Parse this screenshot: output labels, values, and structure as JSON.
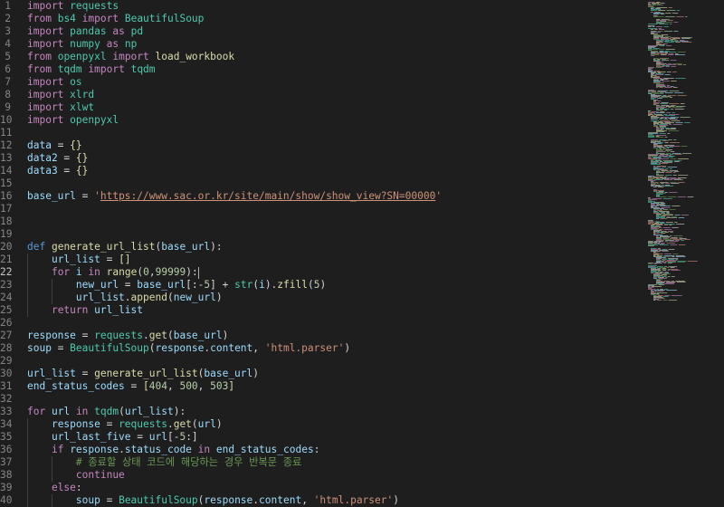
{
  "editor": {
    "active_line": 22,
    "lines": [
      {
        "n": 1,
        "indent": 0,
        "tokens": [
          [
            "kw",
            "import"
          ],
          [
            "op",
            " "
          ],
          [
            "mod",
            "requests"
          ]
        ]
      },
      {
        "n": 2,
        "indent": 0,
        "tokens": [
          [
            "kw",
            "from"
          ],
          [
            "op",
            " "
          ],
          [
            "mod",
            "bs4"
          ],
          [
            "op",
            " "
          ],
          [
            "kw",
            "import"
          ],
          [
            "op",
            " "
          ],
          [
            "mod",
            "BeautifulSoup"
          ]
        ]
      },
      {
        "n": 3,
        "indent": 0,
        "tokens": [
          [
            "kw",
            "import"
          ],
          [
            "op",
            " "
          ],
          [
            "mod",
            "pandas"
          ],
          [
            "op",
            " "
          ],
          [
            "kw",
            "as"
          ],
          [
            "op",
            " "
          ],
          [
            "mod",
            "pd"
          ]
        ]
      },
      {
        "n": 4,
        "indent": 0,
        "tokens": [
          [
            "kw",
            "import"
          ],
          [
            "op",
            " "
          ],
          [
            "mod",
            "numpy"
          ],
          [
            "op",
            " "
          ],
          [
            "kw",
            "as"
          ],
          [
            "op",
            " "
          ],
          [
            "mod",
            "np"
          ]
        ]
      },
      {
        "n": 5,
        "indent": 0,
        "tokens": [
          [
            "kw",
            "from"
          ],
          [
            "op",
            " "
          ],
          [
            "mod",
            "openpyxl"
          ],
          [
            "op",
            " "
          ],
          [
            "kw",
            "import"
          ],
          [
            "op",
            " "
          ],
          [
            "fn",
            "load_workbook"
          ]
        ]
      },
      {
        "n": 6,
        "indent": 0,
        "tokens": [
          [
            "kw",
            "from"
          ],
          [
            "op",
            " "
          ],
          [
            "mod",
            "tqdm"
          ],
          [
            "op",
            " "
          ],
          [
            "kw",
            "import"
          ],
          [
            "op",
            " "
          ],
          [
            "mod",
            "tqdm"
          ]
        ]
      },
      {
        "n": 7,
        "indent": 0,
        "tokens": [
          [
            "kw",
            "import"
          ],
          [
            "op",
            " "
          ],
          [
            "mod",
            "os"
          ]
        ]
      },
      {
        "n": 8,
        "indent": 0,
        "tokens": [
          [
            "kw",
            "import"
          ],
          [
            "op",
            " "
          ],
          [
            "mod",
            "xlrd"
          ]
        ]
      },
      {
        "n": 9,
        "indent": 0,
        "tokens": [
          [
            "kw",
            "import"
          ],
          [
            "op",
            " "
          ],
          [
            "mod",
            "xlwt"
          ]
        ]
      },
      {
        "n": 10,
        "indent": 0,
        "tokens": [
          [
            "kw",
            "import"
          ],
          [
            "op",
            " "
          ],
          [
            "mod",
            "openpyxl"
          ]
        ]
      },
      {
        "n": 11,
        "indent": 0,
        "tokens": []
      },
      {
        "n": 12,
        "indent": 0,
        "tokens": [
          [
            "var",
            "data"
          ],
          [
            "op",
            " = "
          ],
          [
            "fn",
            "{}"
          ]
        ]
      },
      {
        "n": 13,
        "indent": 0,
        "tokens": [
          [
            "var",
            "data2"
          ],
          [
            "op",
            " = "
          ],
          [
            "fn",
            "{}"
          ]
        ]
      },
      {
        "n": 14,
        "indent": 0,
        "tokens": [
          [
            "var",
            "data3"
          ],
          [
            "op",
            " = "
          ],
          [
            "fn",
            "{}"
          ]
        ]
      },
      {
        "n": 15,
        "indent": 0,
        "tokens": []
      },
      {
        "n": 16,
        "indent": 0,
        "tokens": [
          [
            "var",
            "base_url"
          ],
          [
            "op",
            " = "
          ],
          [
            "str",
            "'"
          ],
          [
            "url",
            "https://www.sac.or.kr/site/main/show/show_view?SN=00000"
          ],
          [
            "str",
            "'"
          ]
        ]
      },
      {
        "n": 17,
        "indent": 0,
        "tokens": []
      },
      {
        "n": 18,
        "indent": 0,
        "tokens": []
      },
      {
        "n": 19,
        "indent": 0,
        "tokens": []
      },
      {
        "n": 20,
        "indent": 0,
        "tokens": [
          [
            "dec",
            "def"
          ],
          [
            "op",
            " "
          ],
          [
            "fn",
            "generate_url_list"
          ],
          [
            "op",
            "("
          ],
          [
            "var",
            "base_url"
          ],
          [
            "op",
            "):"
          ]
        ]
      },
      {
        "n": 21,
        "indent": 1,
        "tokens": [
          [
            "var",
            "url_list"
          ],
          [
            "op",
            " = "
          ],
          [
            "fn",
            "[]"
          ]
        ]
      },
      {
        "n": 22,
        "indent": 1,
        "tokens": [
          [
            "kw",
            "for"
          ],
          [
            "op",
            " "
          ],
          [
            "var",
            "i"
          ],
          [
            "op",
            " "
          ],
          [
            "kw",
            "in"
          ],
          [
            "op",
            " "
          ],
          [
            "fn",
            "range"
          ],
          [
            "op",
            "("
          ],
          [
            "num",
            "0"
          ],
          [
            "op",
            ","
          ],
          [
            "num",
            "99999"
          ],
          [
            "op",
            "):"
          ]
        ]
      },
      {
        "n": 23,
        "indent": 2,
        "tokens": [
          [
            "var",
            "new_url"
          ],
          [
            "op",
            " = "
          ],
          [
            "var",
            "base_url"
          ],
          [
            "op",
            "[:-"
          ],
          [
            "num",
            "5"
          ],
          [
            "op",
            "] + "
          ],
          [
            "mod",
            "str"
          ],
          [
            "op",
            "("
          ],
          [
            "var",
            "i"
          ],
          [
            "op",
            ")."
          ],
          [
            "fn",
            "zfill"
          ],
          [
            "op",
            "("
          ],
          [
            "num",
            "5"
          ],
          [
            "op",
            ")"
          ]
        ]
      },
      {
        "n": 24,
        "indent": 2,
        "tokens": [
          [
            "var",
            "url_list"
          ],
          [
            "op",
            "."
          ],
          [
            "fn",
            "append"
          ],
          [
            "op",
            "("
          ],
          [
            "var",
            "new_url"
          ],
          [
            "op",
            ")"
          ]
        ]
      },
      {
        "n": 25,
        "indent": 1,
        "tokens": [
          [
            "kw",
            "return"
          ],
          [
            "op",
            " "
          ],
          [
            "var",
            "url_list"
          ]
        ]
      },
      {
        "n": 26,
        "indent": 0,
        "tokens": []
      },
      {
        "n": 27,
        "indent": 0,
        "tokens": [
          [
            "var",
            "response"
          ],
          [
            "op",
            " = "
          ],
          [
            "mod",
            "requests"
          ],
          [
            "op",
            "."
          ],
          [
            "fn",
            "get"
          ],
          [
            "op",
            "("
          ],
          [
            "var",
            "base_url"
          ],
          [
            "op",
            ")"
          ]
        ]
      },
      {
        "n": 28,
        "indent": 0,
        "tokens": [
          [
            "var",
            "soup"
          ],
          [
            "op",
            " = "
          ],
          [
            "mod",
            "BeautifulSoup"
          ],
          [
            "op",
            "("
          ],
          [
            "var",
            "response"
          ],
          [
            "op",
            "."
          ],
          [
            "var",
            "content"
          ],
          [
            "op",
            ", "
          ],
          [
            "str",
            "'html.parser'"
          ],
          [
            "op",
            ")"
          ]
        ]
      },
      {
        "n": 29,
        "indent": 0,
        "tokens": []
      },
      {
        "n": 30,
        "indent": 0,
        "tokens": [
          [
            "var",
            "url_list"
          ],
          [
            "op",
            " = "
          ],
          [
            "fn",
            "generate_url_list"
          ],
          [
            "op",
            "("
          ],
          [
            "var",
            "base_url"
          ],
          [
            "op",
            ")"
          ]
        ]
      },
      {
        "n": 31,
        "indent": 0,
        "tokens": [
          [
            "var",
            "end_status_codes"
          ],
          [
            "op",
            " = "
          ],
          [
            "fn",
            "["
          ],
          [
            "num",
            "404"
          ],
          [
            "op",
            ", "
          ],
          [
            "num",
            "500"
          ],
          [
            "op",
            ", "
          ],
          [
            "num",
            "503"
          ],
          [
            "fn",
            "]"
          ]
        ]
      },
      {
        "n": 32,
        "indent": 0,
        "tokens": []
      },
      {
        "n": 33,
        "indent": 0,
        "tokens": [
          [
            "kw",
            "for"
          ],
          [
            "op",
            " "
          ],
          [
            "var",
            "url"
          ],
          [
            "op",
            " "
          ],
          [
            "kw",
            "in"
          ],
          [
            "op",
            " "
          ],
          [
            "mod",
            "tqdm"
          ],
          [
            "op",
            "("
          ],
          [
            "var",
            "url_list"
          ],
          [
            "op",
            "):"
          ]
        ]
      },
      {
        "n": 34,
        "indent": 1,
        "tokens": [
          [
            "var",
            "response"
          ],
          [
            "op",
            " = "
          ],
          [
            "mod",
            "requests"
          ],
          [
            "op",
            "."
          ],
          [
            "fn",
            "get"
          ],
          [
            "op",
            "("
          ],
          [
            "var",
            "url"
          ],
          [
            "op",
            ")"
          ]
        ]
      },
      {
        "n": 35,
        "indent": 1,
        "tokens": [
          [
            "var",
            "url_last_five"
          ],
          [
            "op",
            " = "
          ],
          [
            "var",
            "url"
          ],
          [
            "op",
            "[-"
          ],
          [
            "num",
            "5"
          ],
          [
            "op",
            ":]"
          ]
        ]
      },
      {
        "n": 36,
        "indent": 1,
        "tokens": [
          [
            "kw",
            "if"
          ],
          [
            "op",
            " "
          ],
          [
            "var",
            "response"
          ],
          [
            "op",
            "."
          ],
          [
            "var",
            "status_code"
          ],
          [
            "op",
            " "
          ],
          [
            "kw",
            "in"
          ],
          [
            "op",
            " "
          ],
          [
            "var",
            "end_status_codes"
          ],
          [
            "op",
            ":"
          ]
        ]
      },
      {
        "n": 37,
        "indent": 2,
        "tokens": [
          [
            "com",
            "# 종료할 상태 코드에 해당하는 경우 반복문 종료"
          ]
        ]
      },
      {
        "n": 38,
        "indent": 2,
        "tokens": [
          [
            "kw",
            "continue"
          ]
        ]
      },
      {
        "n": 39,
        "indent": 1,
        "tokens": [
          [
            "kw",
            "else"
          ],
          [
            "op",
            ":"
          ]
        ]
      },
      {
        "n": 40,
        "indent": 2,
        "tokens": [
          [
            "var",
            "soup"
          ],
          [
            "op",
            " = "
          ],
          [
            "mod",
            "BeautifulSoup"
          ],
          [
            "op",
            "("
          ],
          [
            "var",
            "response"
          ],
          [
            "op",
            "."
          ],
          [
            "var",
            "content"
          ],
          [
            "op",
            ", "
          ],
          [
            "str",
            "'html.parser'"
          ],
          [
            "op",
            ")"
          ]
        ]
      }
    ]
  },
  "colors": {
    "background": "#1e1e1e",
    "keyword": "#c586c0",
    "def_keyword": "#569cd6",
    "function": "#dcdcaa",
    "variable": "#9cdcfe",
    "module": "#4ec9b0",
    "string": "#ce9178",
    "number": "#b5cea8",
    "comment": "#6a9955",
    "line_number": "#858585"
  }
}
